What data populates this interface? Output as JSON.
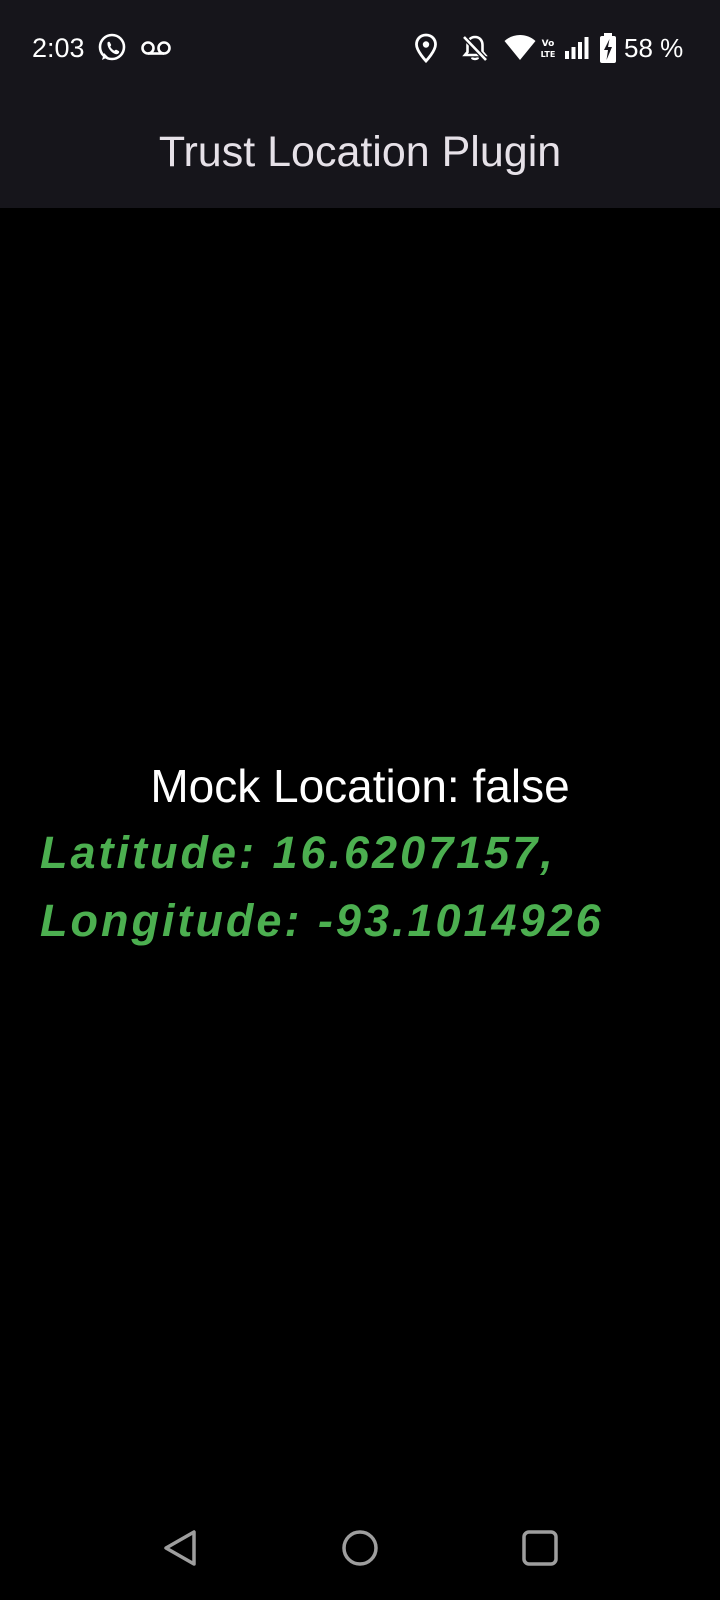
{
  "status_bar": {
    "time": "2:03",
    "battery_text": "58 %",
    "icons": [
      "whatsapp-icon",
      "voicemail-icon",
      "location-icon",
      "notifications-off-icon",
      "wifi-icon",
      "volte-icon",
      "signal-icon",
      "battery-charging-icon"
    ]
  },
  "app_bar": {
    "title": "Trust Location Plugin",
    "background": "#16151b"
  },
  "content": {
    "mock_location": "Mock Location: false",
    "latitude_line": "Latitude: 16.6207157,",
    "longitude_line": "Longitude: -93.1014926",
    "coord_color": "#4caf50"
  },
  "nav_bar": {
    "buttons": [
      "back-icon",
      "home-icon",
      "recents-icon"
    ]
  }
}
